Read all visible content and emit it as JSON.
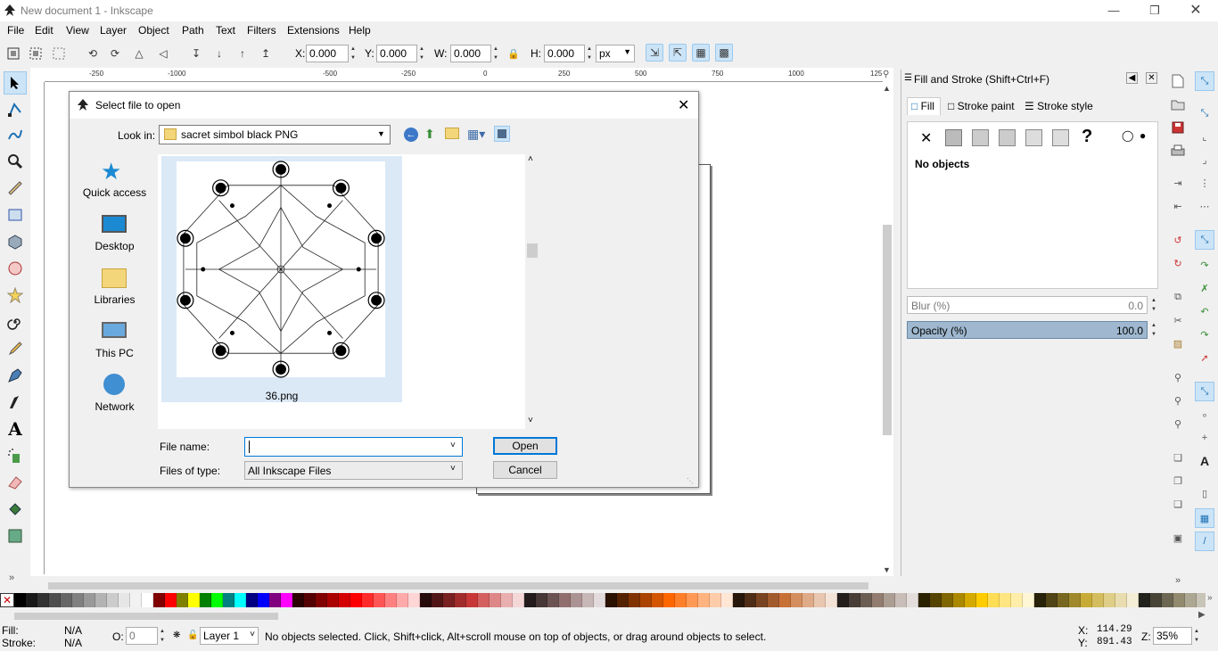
{
  "window": {
    "title": "New document 1 - Inkscape"
  },
  "menu": [
    "File",
    "Edit",
    "View",
    "Layer",
    "Object",
    "Path",
    "Text",
    "Filters",
    "Extensions",
    "Help"
  ],
  "toolbar": {
    "x_label": "X:",
    "x_value": "0.000",
    "y_label": "Y:",
    "y_value": "0.000",
    "w_label": "W:",
    "w_value": "0.000",
    "h_label": "H:",
    "h_value": "0.000",
    "unit": "px"
  },
  "ruler": {
    "h_ticks": [
      "-250",
      "-1000",
      "-500",
      "-250",
      "0",
      "250",
      "500",
      "750",
      "1000",
      "125"
    ]
  },
  "dialog": {
    "title": "Select file to open",
    "look_in_label": "Look in:",
    "look_in_value": "sacret simbol black PNG",
    "places": [
      "Quick access",
      "Desktop",
      "Libraries",
      "This PC",
      "Network"
    ],
    "file": {
      "name": "36.png"
    },
    "file_name_label": "File name:",
    "file_name_value": "",
    "files_of_type_label": "Files of type:",
    "files_of_type_value": "All Inkscape Files",
    "open_button": "Open",
    "cancel_button": "Cancel"
  },
  "fill_panel": {
    "title": "Fill and Stroke (Shift+Ctrl+F)",
    "tabs": [
      "Fill",
      "Stroke paint",
      "Stroke style"
    ],
    "no_objects": "No objects",
    "blur_label": "Blur (%)",
    "blur_value": "0.0",
    "opacity_label": "Opacity (%)",
    "opacity_value": "100.0"
  },
  "status": {
    "fill_label": "Fill:",
    "fill_value": "N/A",
    "stroke_label": "Stroke:",
    "stroke_value": "N/A",
    "o_label": "O:",
    "o_value": "0",
    "layer": "Layer 1",
    "message": "No objects selected. Click, Shift+click, Alt+scroll mouse on top of objects, or drag around objects to select.",
    "x_label": "X:",
    "x_value": "114.29",
    "y_label": "Y:",
    "y_value": "891.43",
    "z_label": "Z:",
    "zoom": "35%"
  },
  "palette": [
    "#000000",
    "#1a1a1a",
    "#333333",
    "#4d4d4d",
    "#666666",
    "#808080",
    "#999999",
    "#b3b3b3",
    "#cccccc",
    "#e6e6e6",
    "#f2f2f2",
    "#ffffff",
    "#800000",
    "#ff0000",
    "#808000",
    "#ffff00",
    "#008000",
    "#00ff00",
    "#008080",
    "#00ffff",
    "#000080",
    "#0000ff",
    "#800080",
    "#ff00ff",
    "#2b0000",
    "#550000",
    "#800000",
    "#aa0000",
    "#d40000",
    "#ff0000",
    "#ff2a2a",
    "#ff5555",
    "#ff8080",
    "#ffaaaa",
    "#ffd5d5",
    "#280b0b",
    "#501616",
    "#782121",
    "#a02c2c",
    "#c83737",
    "#d35f5f",
    "#de8787",
    "#e9afaf",
    "#f4d7d7",
    "#241c1c",
    "#483737",
    "#6c5353",
    "#916f6f",
    "#ac9393",
    "#c8b7b7",
    "#e3dbdb",
    "#2b1100",
    "#552200",
    "#803300",
    "#aa4400",
    "#d45500",
    "#ff6600",
    "#ff7f2a",
    "#ff9955",
    "#ffb380",
    "#ffccaa",
    "#ffe6d5",
    "#28170b",
    "#502d16",
    "#784421",
    "#a05a2c",
    "#c87137",
    "#d38d5f",
    "#deaa87",
    "#e9c6af",
    "#f4e3d7",
    "#241f1c",
    "#483e37",
    "#6c5d53",
    "#917c6f",
    "#ac9d93",
    "#c8beb7",
    "#e3dedb",
    "#2b2200",
    "#554400",
    "#806600",
    "#aa8800",
    "#d4aa00",
    "#ffcc00",
    "#ffdd55",
    "#ffe680",
    "#ffeeaa",
    "#fff6d5",
    "#28220b",
    "#504416",
    "#786721",
    "#a0892c",
    "#c8ab37",
    "#d4bd5f",
    "#dece87",
    "#e9ddaf",
    "#f4eed7",
    "#24221c",
    "#484537",
    "#6c6753",
    "#918a6f",
    "#aca793",
    "#c8c4b7",
    "#e3e2db",
    "#222b00",
    "#445500",
    "#668000"
  ]
}
